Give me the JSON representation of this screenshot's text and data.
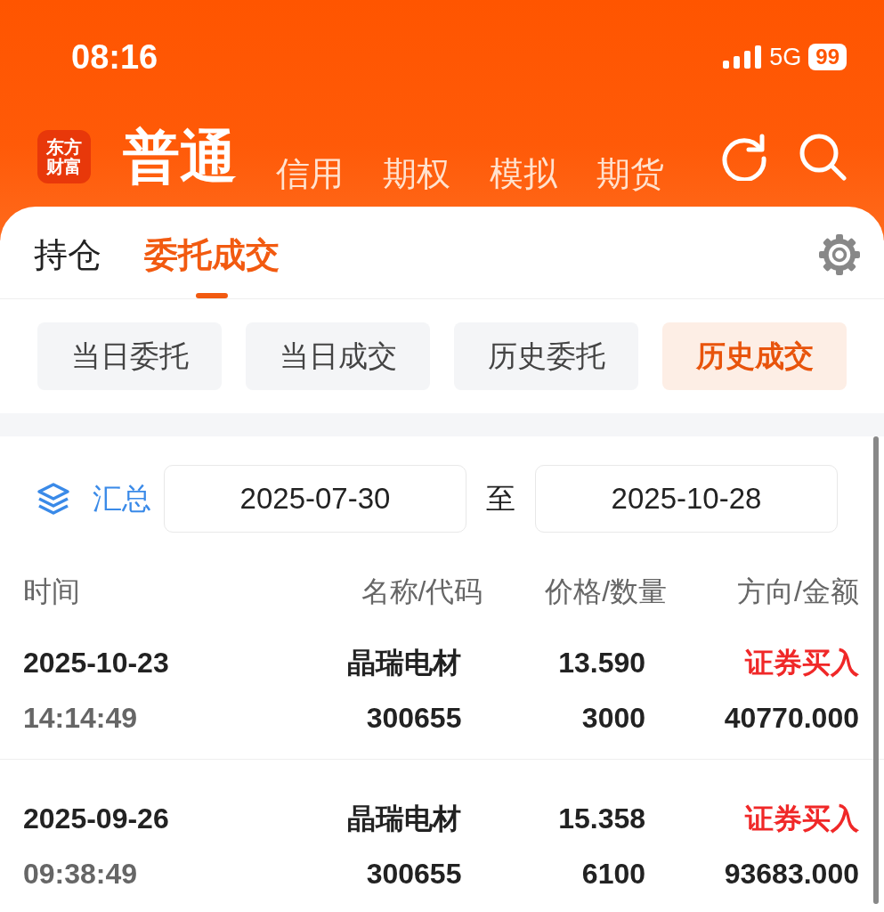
{
  "status_bar": {
    "time": "08:16",
    "network": "5G",
    "battery": "99"
  },
  "logo": {
    "line1": "东方",
    "line2": "财富"
  },
  "account_tabs": [
    {
      "label": "普通",
      "selected": true
    },
    {
      "label": "信用",
      "selected": false
    },
    {
      "label": "期权",
      "selected": false
    },
    {
      "label": "模拟",
      "selected": false
    },
    {
      "label": "期货",
      "selected": false
    }
  ],
  "main_tabs": [
    {
      "label": "持仓",
      "selected": false
    },
    {
      "label": "委托成交",
      "selected": true
    }
  ],
  "filters": [
    {
      "label": "当日委托",
      "selected": false
    },
    {
      "label": "当日成交",
      "selected": false
    },
    {
      "label": "历史委托",
      "selected": false
    },
    {
      "label": "历史成交",
      "selected": true
    }
  ],
  "date_range": {
    "summary": "汇总",
    "start": "2025-07-30",
    "separator": "至",
    "end": "2025-10-28"
  },
  "table": {
    "columns": [
      "时间",
      "名称/代码",
      "价格/数量",
      "方向/金额"
    ],
    "rows": [
      {
        "date": "2025-10-23",
        "time": "14:14:49",
        "name": "晶瑞电材",
        "code": "300655",
        "price": "13.590",
        "quantity": "3000",
        "direction": "证券买入",
        "amount": "40770.000"
      },
      {
        "date": "2025-09-26",
        "time": "09:38:49",
        "name": "晶瑞电材",
        "code": "300655",
        "price": "15.358",
        "quantity": "6100",
        "direction": "证券买入",
        "amount": "93683.000"
      }
    ]
  }
}
